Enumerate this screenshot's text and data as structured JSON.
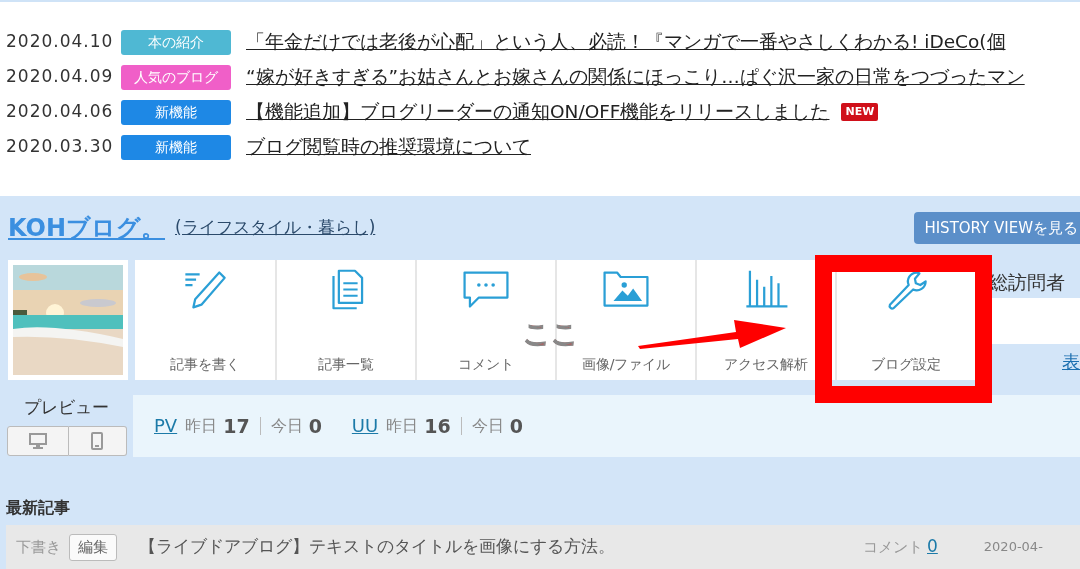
{
  "news": [
    {
      "date": "2020.04.10",
      "category": "本の紹介",
      "color": "#4fb8d3",
      "title": "「年金だけでは老後が心配」という人、必読！『マンガで一番やさしくわかる! iDeCo(個"
    },
    {
      "date": "2020.04.09",
      "category": "人気のブログ",
      "color": "#f05fc8",
      "title": "“嫁が好きすぎる”お姑さんとお嫁さんの関係にほっこり…ぱぐ沢一家の日常をつづったマン"
    },
    {
      "date": "2020.04.06",
      "category": "新機能",
      "color": "#1e88e5",
      "title": "【機能追加】ブログリーダーの通知ON/OFF機能をリリースしました",
      "badge": "NEW"
    },
    {
      "date": "2020.03.30",
      "category": "新機能",
      "color": "#1e88e5",
      "title": "ブログ閲覧時の推奨環境について"
    }
  ],
  "blog": {
    "name": "KOHブログ。",
    "category": "(ライフスタイル・暮らし)",
    "history_button": "HISTORY VIEWを見る",
    "preview_label": "プレビュー",
    "tools": [
      {
        "label": "記事を書く"
      },
      {
        "label": "記事一覧"
      },
      {
        "label": "コメント"
      },
      {
        "label": "画像/ファイル"
      },
      {
        "label": "アクセス解析"
      },
      {
        "label": "ブログ設定"
      }
    ],
    "visitors_label": "総訪問者",
    "side_link": "表",
    "stats": [
      {
        "label": "PV",
        "yesterday_label": "昨日",
        "yesterday": "17",
        "today_label": "今日",
        "today": "0"
      },
      {
        "label": "UU",
        "yesterday_label": "昨日",
        "yesterday": "16",
        "today_label": "今日",
        "today": "0"
      }
    ]
  },
  "latest": {
    "heading": "最新記事",
    "articles": [
      {
        "status": "下書き",
        "edit": "編集",
        "title": "【ライブドアブログ】テキストのタイトルを画像にする方法。",
        "comment_label": "コメント",
        "comments": "0",
        "date": "2020-04-"
      }
    ]
  },
  "annotation": {
    "text": "ここ"
  }
}
